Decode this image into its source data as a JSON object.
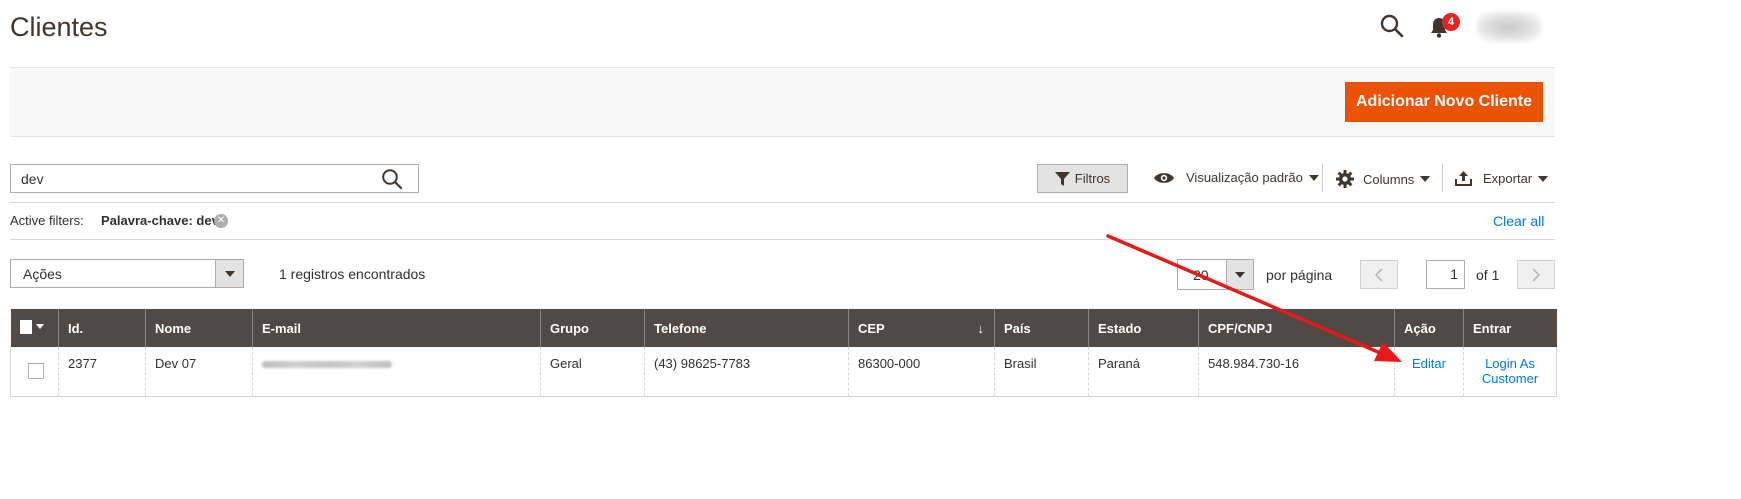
{
  "header": {
    "title": "Clientes",
    "notifications_count": "4"
  },
  "action_bar": {
    "add_button": "Adicionar Novo Cliente"
  },
  "toolbar": {
    "search_value": "dev",
    "filters_label": "Filtros",
    "view_label": "Visualização padrão",
    "columns_label": "Columns",
    "export_label": "Exportar"
  },
  "active_filters": {
    "label": "Active filters:",
    "chip": "Palavra-chave: dev",
    "clear_all": "Clear all"
  },
  "massactions": {
    "label": "Ações",
    "records_found": "1 registros encontrados"
  },
  "pagination": {
    "per_page_value": "20",
    "per_page_label": "por página",
    "current_page": "1",
    "of_label": "of 1"
  },
  "grid": {
    "columns": [
      "Id.",
      "Nome",
      "E-mail",
      "Grupo",
      "Telefone",
      "CEP",
      "País",
      "Estado",
      "CPF/CNPJ",
      "Ação",
      "Entrar"
    ],
    "sort_indicator": "↓",
    "rows": [
      {
        "id": "2377",
        "nome": "Dev 07",
        "grupo": "Geral",
        "telefone": "(43) 98625-7783",
        "cep": "86300-000",
        "pais": "Brasil",
        "estado": "Paraná",
        "cpf": "548.984.730-16",
        "acao": "Editar",
        "entrar": "Login As Customer"
      }
    ]
  },
  "colors": {
    "accent": "#eb5202",
    "link": "#007bdb",
    "header_bg": "#514943",
    "annotation_arrow": "#e8191b"
  }
}
